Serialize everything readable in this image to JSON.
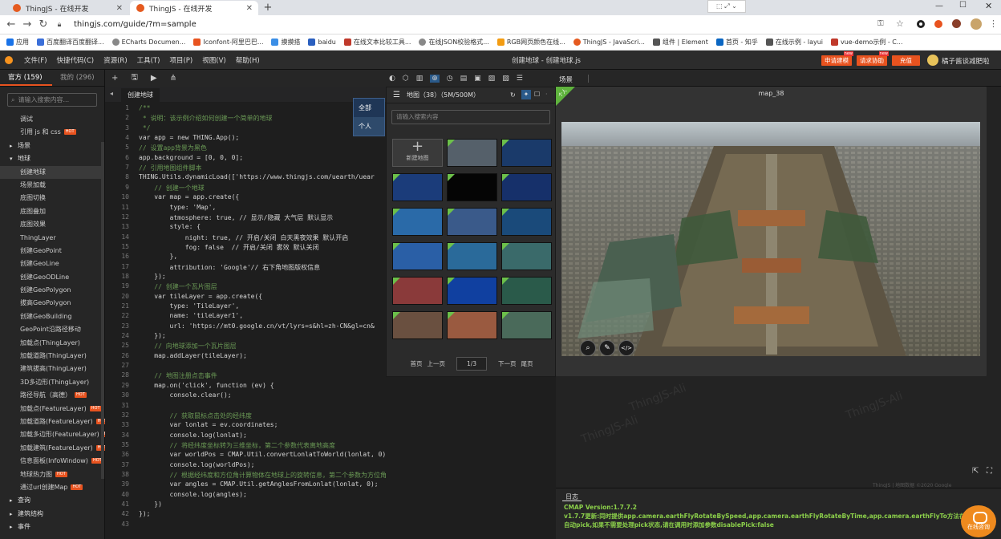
{
  "browser": {
    "tabs": [
      {
        "title": "ThingJS - 在线开发"
      },
      {
        "title": "ThingJS - 在线开发"
      }
    ],
    "url": "thingjs.com/guide/?m=sample",
    "bookmarks": [
      "应用",
      "百度翻译百度翻译...",
      "ECharts Documen...",
      "Iconfont-阿里巴巴...",
      "摸摸搭",
      "baidu",
      "在线文本比较工具...",
      "在线JSON校验格式...",
      "RGB网页颜色在线...",
      "ThingJS - JavaScri...",
      "组件 | Element",
      "首页 - 知乎",
      "在线示例 - layui",
      "vue-demo示例 - C..."
    ]
  },
  "app": {
    "menus": [
      "文件(F)",
      "快捷代码(C)",
      "资源(R)",
      "工具(T)",
      "项目(P)",
      "视图(V)",
      "帮助(H)"
    ],
    "title": "创建地球 - 创建地球.js",
    "header_buttons": [
      "申请建模",
      "请求协助",
      "充值"
    ],
    "new_tag": "new",
    "username": "橘子酱谈减肥啦"
  },
  "sidebar": {
    "tab_official": "官方 (159)",
    "tab_mine": "我的 (296)",
    "search_placeholder": "请输入搜索内容...",
    "hot_label": "HOT",
    "items": [
      {
        "label": "调试",
        "cat": false
      },
      {
        "label": "引用 js 和 css",
        "cat": false,
        "hot": true
      },
      {
        "label": "场景",
        "cat": true,
        "arrow": "▸"
      },
      {
        "label": "地球",
        "cat": true,
        "arrow": "▾"
      },
      {
        "label": "创建地球",
        "cat": false,
        "selected": true
      },
      {
        "label": "场景加载",
        "cat": false
      },
      {
        "label": "底图切换",
        "cat": false
      },
      {
        "label": "底图叠加",
        "cat": false
      },
      {
        "label": "底图效果",
        "cat": false
      },
      {
        "label": "ThingLayer",
        "cat": false
      },
      {
        "label": "创建GeoPoint",
        "cat": false
      },
      {
        "label": "创建GeoLine",
        "cat": false
      },
      {
        "label": "创建GeoODLine",
        "cat": false
      },
      {
        "label": "创建GeoPolygon",
        "cat": false
      },
      {
        "label": "拔高GeoPolygon",
        "cat": false
      },
      {
        "label": "创建GeoBuilding",
        "cat": false
      },
      {
        "label": "GeoPoint沿路径移动",
        "cat": false
      },
      {
        "label": "加载点(ThingLayer)",
        "cat": false
      },
      {
        "label": "加载道路(ThingLayer)",
        "cat": false
      },
      {
        "label": "建筑拔高(ThingLayer)",
        "cat": false
      },
      {
        "label": "3D多边形(ThingLayer)",
        "cat": false
      },
      {
        "label": "路径导航（高德）",
        "cat": false,
        "hot": true
      },
      {
        "label": "加载点(FeatureLayer)",
        "cat": false,
        "hot": true
      },
      {
        "label": "加载道路(FeatureLayer)",
        "cat": false,
        "hot": true
      },
      {
        "label": "加载多边形(FeatureLayer)",
        "cat": false,
        "hot": true
      },
      {
        "label": "加载建筑(FeatureLayer)",
        "cat": false,
        "hot": true
      },
      {
        "label": "信息面板(InfoWindow)",
        "cat": false,
        "hot": true
      },
      {
        "label": "地球热力图",
        "cat": false,
        "hot": true
      },
      {
        "label": "通过url创建Map",
        "cat": false,
        "hot": true
      },
      {
        "label": "查询",
        "cat": true,
        "arrow": "▸"
      },
      {
        "label": "建筑结构",
        "cat": true,
        "arrow": "▸"
      },
      {
        "label": "事件",
        "cat": true,
        "arrow": "▸"
      }
    ]
  },
  "editor": {
    "tab": "创建地球",
    "icons": [
      "plus-icon",
      "save-icon",
      "run-icon",
      "share-icon"
    ],
    "lines": [
      "/**",
      " * 说明：该示例介绍如何创建一个简单的地球",
      " */",
      "var app = new THING.App();",
      "// 设置app背景为黑色",
      "app.background = [0, 0, 0];",
      "// 引用地图组件脚本",
      "THING.Utils.dynamicLoad(['https://www.thingjs.com/uearth/uear",
      "    // 创建一个地球",
      "    var map = app.create({",
      "        type: 'Map',",
      "        atmosphere: true, // 显示/隐藏 大气层 默认显示",
      "        style: {",
      "            night: true, // 开启/关闭 白天黑夜效果 默认开启",
      "            fog: false  // 开启/关闭 雾效 默认关闭",
      "        },",
      "        attribution: 'Google'// 右下角地图版权信息",
      "    });",
      "    // 创建一个瓦片图层",
      "    var tileLayer = app.create({",
      "        type: 'TileLayer',",
      "        name: 'tileLayer1',",
      "        url: 'https://mt0.google.cn/vt/lyrs=s&hl=zh-CN&gl=cn&",
      "    });",
      "    // 向地球添加一个瓦片图层",
      "    map.addLayer(tileLayer);",
      "",
      "    // 地图注册点击事件",
      "    map.on('click', function (ev) {",
      "        console.clear();",
      "",
      "        // 获取鼠标点击处的经纬度",
      "        var lonlat = ev.coordinates;",
      "        console.log(lonlat);",
      "        // 将经纬度坐标转为三维坐标，第二个参数代表离地高度",
      "        var worldPos = CMAP.Util.convertLonlatToWorld(lonlat, 0)",
      "        console.log(worldPos);",
      "        // 根据经纬度和方位角计算物体在地球上的旋转信息，第二个参数为方位角 默认0",
      "        var angles = CMAP.Util.getAnglesFromLonlat(lonlat, 0);",
      "        console.log(angles);",
      "    })",
      "});",
      ""
    ]
  },
  "dropdown": {
    "options": [
      "全部",
      "个人"
    ]
  },
  "mappanel": {
    "header": "地图（38）（5M/500M）",
    "search_placeholder": "请输入搜索内容",
    "new_map_label": "新建地图",
    "thumb_colors": [
      "#55606a",
      "#1a3a6a",
      "#1b3c7a",
      "#050505",
      "#16306a",
      "#2a6aa8",
      "#3a5a8a",
      "#1a4a7a",
      "#2a5fa6",
      "#2a6a9a",
      "#3a6a6a",
      "#8a3a3a",
      "#1040a0",
      "#2a5a4a",
      "#6a5040",
      "#9a5a40",
      "#4a6a5a"
    ],
    "pager": {
      "first": "首页",
      "prev": "上一页",
      "page": "1/3",
      "next": "下一页",
      "last": "尾页"
    }
  },
  "scene": {
    "tab": "场景",
    "preview_title": "map_38",
    "ribbon": "个人",
    "preview_buttons": [
      "zoom-icon",
      "edit-icon",
      "code-icon"
    ],
    "attribution": "ThingJS | 地图数据 ©2020 Google"
  },
  "log": {
    "tab": "日志",
    "lines": [
      "CMAP Version:1.7.7.2",
      "v1.7.7更新:同时提供app.camera.earthFlyRotateBySpeed,app.camera.earthFlyRotateByTime,app.camera.earthFlyTo方法在运行时自动pick,如果不需要处理pick状态,请在调用时添加参数disablePick:false"
    ]
  },
  "consult_label": "在线咨询"
}
